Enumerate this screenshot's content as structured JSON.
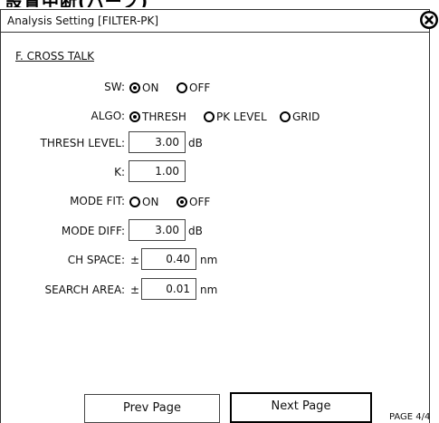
{
  "window": {
    "header_fragment": "設置中断(ハーフ)",
    "title": "Analysis Setting [FILTER-PK]"
  },
  "section": {
    "title": "F. CROSS TALK"
  },
  "sw": {
    "label": "SW:",
    "options": [
      "ON",
      "OFF"
    ],
    "selected": "ON"
  },
  "algo": {
    "label": "ALGO:",
    "options": [
      "THRESH",
      "PK LEVEL",
      "GRID"
    ],
    "selected": "THRESH"
  },
  "thresh_level": {
    "label": "THRESH LEVEL:",
    "value": "3.00",
    "unit": "dB"
  },
  "k": {
    "label": "K:",
    "value": "1.00"
  },
  "mode_fit": {
    "label": "MODE FIT:",
    "options": [
      "ON",
      "OFF"
    ],
    "selected": "OFF"
  },
  "mode_diff": {
    "label": "MODE DIFF:",
    "value": "3.00",
    "unit": "dB"
  },
  "ch_space": {
    "label": "CH SPACE:",
    "prefix": "±",
    "value": "0.40",
    "unit": "nm"
  },
  "search_area": {
    "label": "SEARCH AREA:",
    "prefix": "±",
    "value": "0.01",
    "unit": "nm"
  },
  "nav": {
    "prev_label": "Prev Page",
    "next_label": "Next Page",
    "page_indicator": "PAGE 4/4"
  },
  "icons": {
    "close": "close-circle-icon"
  }
}
